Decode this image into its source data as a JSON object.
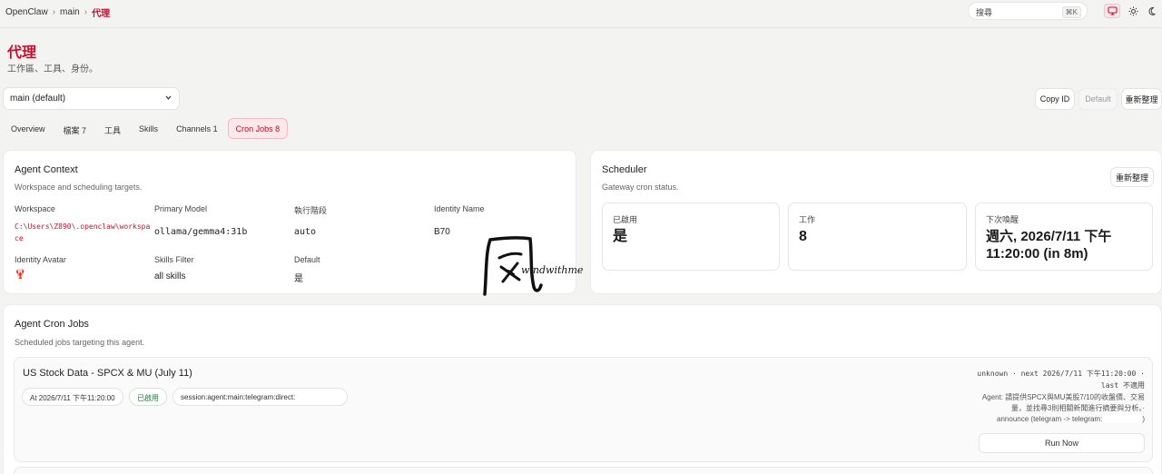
{
  "breadcrumb": {
    "items": [
      "OpenClaw",
      "main"
    ],
    "current": "代理",
    "separator": "›"
  },
  "search": {
    "placeholder": "搜尋",
    "shortcut": "⌘K"
  },
  "topbar_icons": [
    "monitor-icon",
    "sun-icon",
    "moon-icon"
  ],
  "page": {
    "title": "代理",
    "subtitle": "工作區、工具、身份。"
  },
  "agent_select": {
    "value": "main (default)"
  },
  "actions": {
    "copy_id": "Copy ID",
    "default": "Default",
    "refresh": "重新整理"
  },
  "tabs": [
    {
      "label": "Overview",
      "active": false
    },
    {
      "label": "檔案 7",
      "active": false
    },
    {
      "label": "工具",
      "active": false
    },
    {
      "label": "Skills",
      "active": false
    },
    {
      "label": "Channels 1",
      "active": false
    },
    {
      "label": "Cron Jobs 8",
      "active": true
    }
  ],
  "agent_context": {
    "title": "Agent Context",
    "subtitle": "Workspace and scheduling targets.",
    "fields": {
      "workspace": {
        "label": "Workspace",
        "value": "C:\\Users\\Z890\\.openclaw\\workspace"
      },
      "primary_model": {
        "label": "Primary Model",
        "value": "ollama/gemma4:31b"
      },
      "run_stage": {
        "label": "執行階段",
        "value": "auto"
      },
      "identity_name": {
        "label": "Identity Name",
        "value": "B70"
      },
      "identity_avatar": {
        "label": "Identity Avatar",
        "value": "🦞"
      },
      "skills_filter": {
        "label": "Skills Filter",
        "value": "all skills"
      },
      "default": {
        "label": "Default",
        "value": "是"
      }
    }
  },
  "watermark": {
    "glyph": "風",
    "text": "windwithme"
  },
  "scheduler": {
    "title": "Scheduler",
    "subtitle": "Gateway cron status.",
    "refresh_label": "重新整理",
    "stats": {
      "enabled": {
        "label": "已啟用",
        "value": "是"
      },
      "jobs": {
        "label": "工作",
        "value": "8"
      },
      "next_wake": {
        "label": "下次喚醒",
        "value": "週六, 2026/7/11 下午 11:20:00 (in 8m)"
      }
    }
  },
  "cron_jobs": {
    "title": "Agent Cron Jobs",
    "subtitle": "Scheduled jobs targeting this agent.",
    "jobs": [
      {
        "title": "US Stock Data - SPCX & MU (July 11)",
        "schedule": "At 2026/7/11 下午11:20:00",
        "status": "已啟用",
        "session": "session:agent:main:telegram:direct:",
        "meta_line1": "unknown · next 2026/7/11 下午11:20:00 ·",
        "meta_line2": "last 不適用",
        "desc_line1": "Agent: 請提供SPCX與MU美股7/10的收盤價、交易",
        "desc_line2": "量，並找尋3則相關新聞進行摘要與分析。·",
        "desc_line3": "announce (telegram -> telegram:",
        "run_label": "Run Now"
      }
    ]
  },
  "colors": {
    "accent": "#c8102e",
    "accent_bg": "#fde8ea",
    "success": "#1f7a3a"
  }
}
